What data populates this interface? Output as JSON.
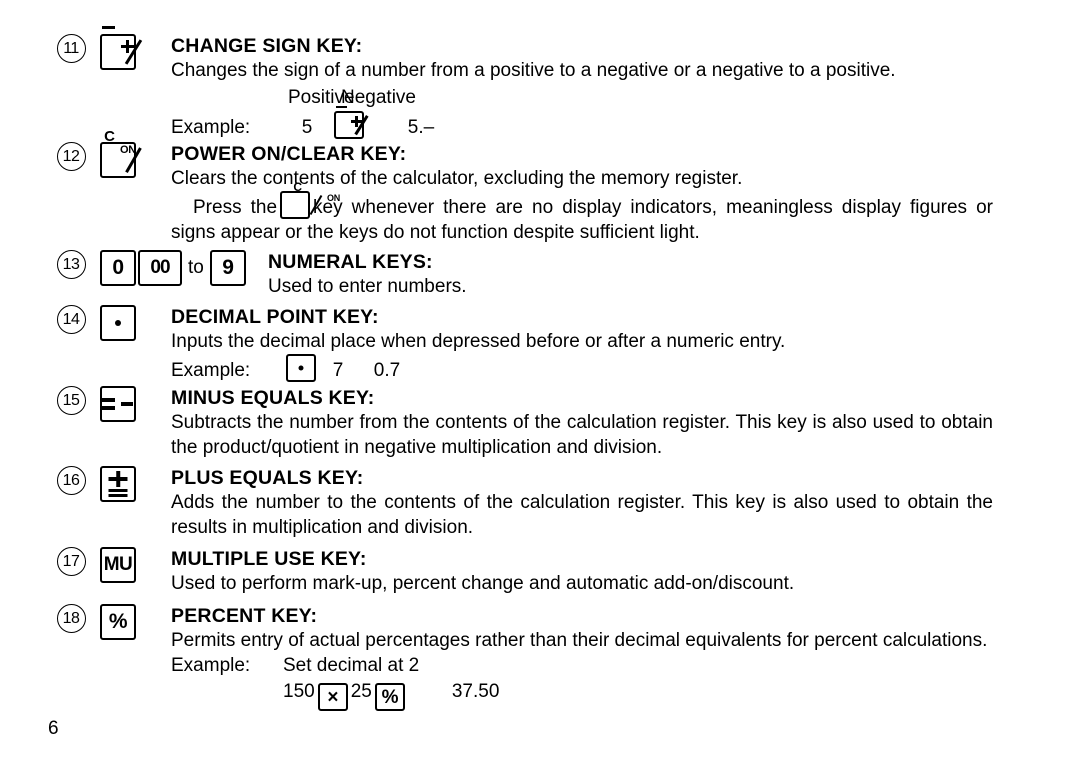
{
  "page": {
    "number": "6"
  },
  "entries": [
    {
      "index": "11",
      "key_icon": "plus-minus-key-icon",
      "heading": "CHANGE SIGN KEY:",
      "body": "Changes the sign of a number from a positive to a negative or a negative to a positive.",
      "example": {
        "col_label_1": "Positive",
        "col_label_2": "Negative",
        "label": "Example:",
        "value_1": "5",
        "key_icon": "plus-minus-key-icon",
        "value_2": "5.–"
      }
    },
    {
      "index": "12",
      "key_icon": "power-on-clear-key-icon",
      "heading": "POWER ON/CLEAR KEY:",
      "body_1": "Clears the contents of the calculator, excluding the memory register.",
      "body_2_before": "Press the",
      "body_2_key_icon": "power-on-clear-key-icon",
      "body_2_after": "key whenever there are no display indicators, meaningless display figures or signs appear or the keys do not function despite sufficient light."
    },
    {
      "index": "13",
      "keys": [
        {
          "label": "0",
          "icon": "numeral-key-0-icon"
        },
        {
          "label": "00",
          "icon": "numeral-key-00-icon"
        },
        {
          "label": "to",
          "icon": "to-label"
        },
        {
          "label": "9",
          "icon": "numeral-key-9-icon"
        }
      ],
      "heading": "NUMERAL KEYS:",
      "body": "Used to enter numbers."
    },
    {
      "index": "14",
      "key_icon": "decimal-point-key-icon",
      "heading": "DECIMAL POINT KEY:",
      "body": "Inputs the decimal place when depressed before or after a numeric entry.",
      "example": {
        "label": "Example:",
        "key_icon": "decimal-point-key-icon",
        "value_1": "7",
        "value_2": "0.7"
      }
    },
    {
      "index": "15",
      "key_icon": "minus-equals-key-icon",
      "heading": "MINUS EQUALS KEY:",
      "body": "Subtracts the number from the contents of the calculation register. This key is also used to obtain the product/quotient in negative multiplication and division."
    },
    {
      "index": "16",
      "key_icon": "plus-equals-key-icon",
      "heading": "PLUS EQUALS KEY:",
      "body": "Adds the number to the contents of the calculation register. This key is also used to obtain the results in multiplication and division."
    },
    {
      "index": "17",
      "key_icon": "multiple-use-key-icon",
      "key_label": "MU",
      "heading": "MULTIPLE USE KEY:",
      "body": "Used to perform mark-up, percent change and automatic add-on/discount."
    },
    {
      "index": "18",
      "key_icon": "percent-key-icon",
      "key_label": "%",
      "heading": "PERCENT KEY:",
      "body": "Permits entry of actual percentages rather than their decimal equivalents for percent calculations.",
      "example": {
        "label": "Example:",
        "line_1": "Set decimal at 2",
        "value_1": "150",
        "key_1_icon": "multiply-key-icon",
        "key_1_label": "×",
        "value_2": "25",
        "key_2_icon": "percent-key-icon",
        "key_2_label": "%",
        "result": "37.50"
      }
    }
  ]
}
